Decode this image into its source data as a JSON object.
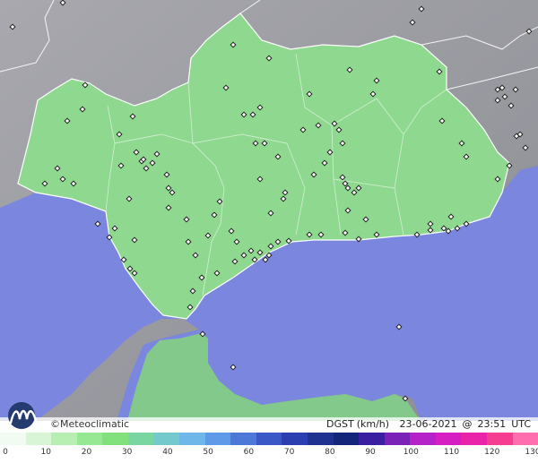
{
  "brand": {
    "name": "Meteoclimatic",
    "symbol": "©"
  },
  "info": {
    "variable": "DGST",
    "units": "(km/h)",
    "date": "23-06-2021",
    "at": "@",
    "time": "23:51",
    "timezone": "UTC"
  },
  "scale": {
    "ticks": [
      "0",
      "10",
      "20",
      "30",
      "40",
      "50",
      "60",
      "70",
      "80",
      "90",
      "100",
      "110",
      "120",
      "130"
    ],
    "colors": [
      "#f2fbf1",
      "#d8f5d5",
      "#b7efb3",
      "#96e892",
      "#82e07d",
      "#7ad6a0",
      "#74c9cd",
      "#6fb7e8",
      "#5e9ae8",
      "#4c78d8",
      "#3a58c6",
      "#2b3fb0",
      "#1f3290",
      "#142679",
      "#3a1fa0",
      "#7a22b8",
      "#b422c8",
      "#d61fc2",
      "#ea24a8",
      "#f53d91",
      "#ff6fb0"
    ]
  },
  "map": {
    "colors": {
      "sea": "#7b86de",
      "land_outside": "#8e8e96",
      "andalusia": "#8ed88f",
      "morocco": "#82c98b",
      "border": "#ffffff",
      "station": "#ffffff"
    },
    "stations": [
      [
        14,
        30
      ],
      [
        70,
        3
      ],
      [
        95,
        95
      ],
      [
        148,
        130
      ],
      [
        133,
        150
      ],
      [
        152,
        170
      ],
      [
        158,
        180
      ],
      [
        163,
        188
      ],
      [
        170,
        182
      ],
      [
        135,
        185
      ],
      [
        92,
        122
      ],
      [
        75,
        135
      ],
      [
        64,
        188
      ],
      [
        82,
        205
      ],
      [
        70,
        200
      ],
      [
        50,
        205
      ],
      [
        122,
        265
      ],
      [
        150,
        268
      ],
      [
        138,
        290
      ],
      [
        145,
        300
      ],
      [
        150,
        305
      ],
      [
        186,
        195
      ],
      [
        188,
        210
      ],
      [
        208,
        245
      ],
      [
        210,
        270
      ],
      [
        232,
        263
      ],
      [
        245,
        225
      ],
      [
        218,
        285
      ],
      [
        225,
        310
      ],
      [
        215,
        325
      ],
      [
        212,
        343
      ],
      [
        160,
        178
      ],
      [
        175,
        172
      ],
      [
        260,
        50
      ],
      [
        300,
        65
      ],
      [
        252,
        98
      ],
      [
        282,
        128
      ],
      [
        272,
        128
      ],
      [
        290,
        120
      ],
      [
        285,
        160
      ],
      [
        295,
        160
      ],
      [
        310,
        175
      ],
      [
        338,
        145
      ],
      [
        345,
        105
      ],
      [
        355,
        140
      ],
      [
        373,
        138
      ],
      [
        378,
        145
      ],
      [
        382,
        160
      ],
      [
        362,
        182
      ],
      [
        368,
        170
      ],
      [
        350,
        195
      ],
      [
        385,
        205
      ],
      [
        388,
        210
      ],
      [
        395,
        215
      ],
      [
        382,
        198
      ],
      [
        400,
        210
      ],
      [
        388,
        235
      ],
      [
        408,
        245
      ],
      [
        416,
        105
      ],
      [
        390,
        78
      ],
      [
        420,
        90
      ],
      [
        490,
        80
      ],
      [
        493,
        135
      ],
      [
        515,
        160
      ],
      [
        520,
        175
      ],
      [
        555,
        200
      ],
      [
        568,
        185
      ],
      [
        576,
        152
      ],
      [
        586,
        165
      ],
      [
        555,
        100
      ],
      [
        560,
        98
      ],
      [
        563,
        108
      ],
      [
        570,
        118
      ],
      [
        555,
        112
      ],
      [
        575,
        100
      ],
      [
        580,
        150
      ],
      [
        590,
        35
      ],
      [
        460,
        25
      ],
      [
        470,
        10
      ],
      [
        322,
        269
      ],
      [
        310,
        270
      ],
      [
        302,
        275
      ],
      [
        300,
        285
      ],
      [
        296,
        290
      ],
      [
        290,
        282
      ],
      [
        284,
        290
      ],
      [
        280,
        280
      ],
      [
        272,
        285
      ],
      [
        262,
        292
      ],
      [
        264,
        270
      ],
      [
        242,
        305
      ],
      [
        226,
        373
      ],
      [
        260,
        410
      ],
      [
        345,
        262
      ],
      [
        358,
        262
      ],
      [
        385,
        260
      ],
      [
        400,
        267
      ],
      [
        420,
        262
      ],
      [
        465,
        262
      ],
      [
        480,
        257
      ],
      [
        495,
        255
      ],
      [
        500,
        258
      ],
      [
        510,
        255
      ],
      [
        520,
        250
      ],
      [
        503,
        242
      ],
      [
        445,
        365
      ],
      [
        452,
        445
      ],
      [
        480,
        250
      ],
      [
        316,
        222
      ],
      [
        318,
        215
      ],
      [
        290,
        200
      ],
      [
        302,
        238
      ],
      [
        258,
        258
      ],
      [
        239,
        240
      ],
      [
        192,
        215
      ],
      [
        144,
        222
      ],
      [
        128,
        255
      ],
      [
        109,
        250
      ],
      [
        188,
        232
      ]
    ]
  }
}
